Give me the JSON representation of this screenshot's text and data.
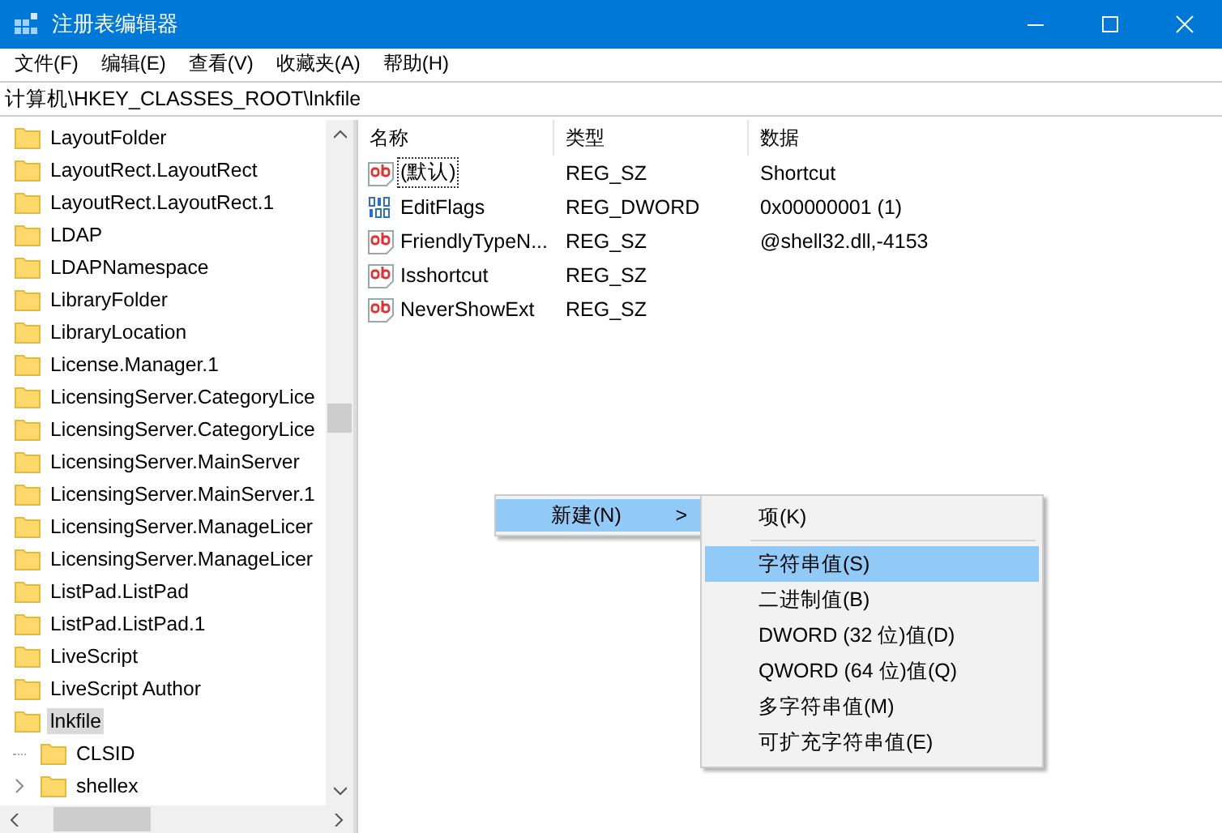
{
  "window": {
    "title": "注册表编辑器"
  },
  "menu_bar": [
    "文件(F)",
    "编辑(E)",
    "查看(V)",
    "收藏夹(A)",
    "帮助(H)"
  ],
  "address_bar": {
    "value": "计算机\\HKEY_CLASSES_ROOT\\lnkfile"
  },
  "tree": {
    "items": [
      {
        "label": "LayoutFolder",
        "selected": false
      },
      {
        "label": "LayoutRect.LayoutRect",
        "selected": false
      },
      {
        "label": "LayoutRect.LayoutRect.1",
        "selected": false
      },
      {
        "label": "LDAP",
        "selected": false
      },
      {
        "label": "LDAPNamespace",
        "selected": false
      },
      {
        "label": "LibraryFolder",
        "selected": false
      },
      {
        "label": "LibraryLocation",
        "selected": false
      },
      {
        "label": "License.Manager.1",
        "selected": false
      },
      {
        "label": "LicensingServer.CategoryLice",
        "selected": false
      },
      {
        "label": "LicensingServer.CategoryLice",
        "selected": false
      },
      {
        "label": "LicensingServer.MainServer",
        "selected": false
      },
      {
        "label": "LicensingServer.MainServer.1",
        "selected": false
      },
      {
        "label": "LicensingServer.ManageLicer",
        "selected": false
      },
      {
        "label": "LicensingServer.ManageLicer",
        "selected": false
      },
      {
        "label": "ListPad.ListPad",
        "selected": false
      },
      {
        "label": "ListPad.ListPad.1",
        "selected": false
      },
      {
        "label": "LiveScript",
        "selected": false
      },
      {
        "label": "LiveScript Author",
        "selected": false
      },
      {
        "label": "lnkfile",
        "selected": true,
        "children": [
          {
            "label": "CLSID",
            "selected": false
          },
          {
            "label": "shellex",
            "selected": false,
            "expanded": false
          }
        ]
      }
    ]
  },
  "values": {
    "columns": [
      "名称",
      "类型",
      "数据"
    ],
    "rows": [
      {
        "kind": "string",
        "name": "(默认)",
        "type": "REG_SZ",
        "data": "Shortcut",
        "focused": true
      },
      {
        "kind": "binary",
        "name": "EditFlags",
        "type": "REG_DWORD",
        "data": "0x00000001 (1)",
        "focused": false
      },
      {
        "kind": "string",
        "name": "FriendlyTypeN...",
        "type": "REG_SZ",
        "data": "@shell32.dll,-4153",
        "focused": false
      },
      {
        "kind": "string",
        "name": "Isshortcut",
        "type": "REG_SZ",
        "focused": false
      },
      {
        "kind": "string",
        "name": "NeverShowExt",
        "type": "REG_SZ",
        "focused": false
      }
    ]
  },
  "context_menu": {
    "items": [
      {
        "label": "新建(N)",
        "arrow": ">",
        "selected": true
      }
    ],
    "submenu": [
      {
        "kind": "item",
        "label": "项(K)",
        "selected": false
      },
      {
        "kind": "separator"
      },
      {
        "kind": "item",
        "label": "字符串值(S)",
        "selected": true
      },
      {
        "kind": "item",
        "label": "二进制值(B)",
        "selected": false
      },
      {
        "kind": "item",
        "label": "DWORD (32 位)值(D)",
        "selected": false
      },
      {
        "kind": "item",
        "label": "QWORD (64 位)值(Q)",
        "selected": false
      },
      {
        "kind": "item",
        "label": "多字符串值(M)",
        "selected": false
      },
      {
        "kind": "item",
        "label": "可扩充字符串值(E)",
        "selected": false
      }
    ]
  }
}
